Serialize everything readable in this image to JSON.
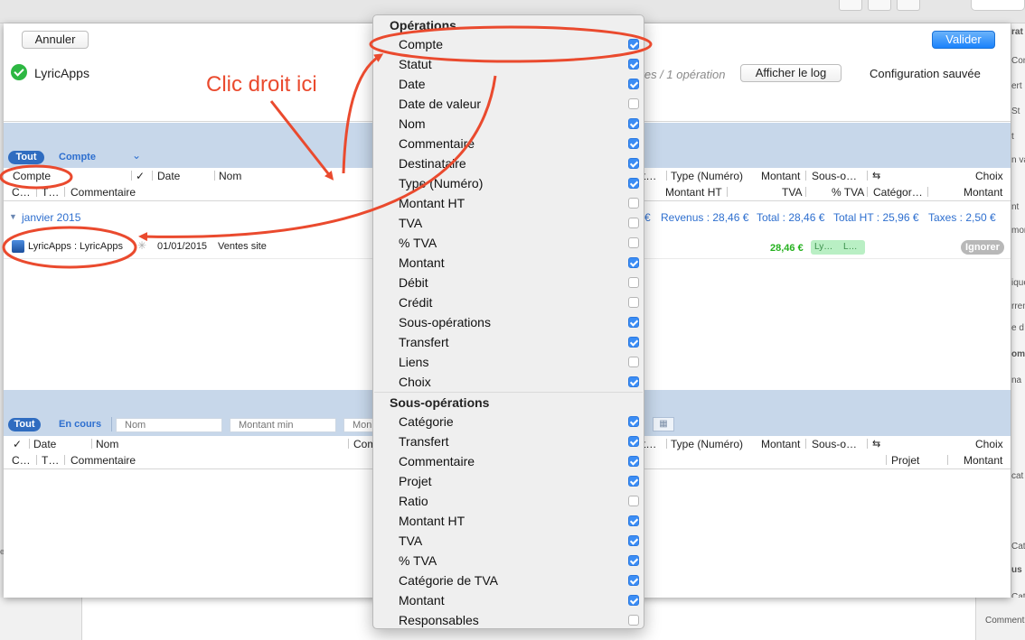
{
  "main": {
    "cancel_label": "Annuler",
    "validate_label": "Valider",
    "app_name": "LyricApps",
    "ops_summary": "ptes / 1 opération",
    "show_log_label": "Afficher le log",
    "config_saved": "Configuration sauvée"
  },
  "upper": {
    "tab_all": "Tout",
    "tab_account": "Compte",
    "headers_row1": {
      "compte": "Compte",
      "check": "✓",
      "date": "Date",
      "nom": "Nom",
      "t_abbr": "t…",
      "type": "Type (Numéro)",
      "montant": "Montant",
      "sous": "Sous-o…",
      "choix": "Choix"
    },
    "headers_row2": {
      "c": "C…",
      "t": "T…",
      "commentaire": "Commentaire",
      "montant_ht": "Montant HT",
      "tva": "TVA",
      "pct_tva": "% TVA",
      "categorie": "Catégor…",
      "montant": "Montant"
    },
    "group": {
      "label": "janvier 2015",
      "euro_frag": "€",
      "revenus": "Revenus : 28,46 €",
      "total": "Total : 28,46 €",
      "total_ht": "Total HT : 25,96 €",
      "taxes": "Taxes : 2,50 €"
    },
    "row": {
      "account": "LyricApps : LyricApps",
      "date": "01/01/2015",
      "name": "Ventes site",
      "amount": "28,46 €",
      "tag1": "Ly…",
      "tag2": "L…",
      "ignore_label": "Ignorer"
    }
  },
  "lower": {
    "tab_all": "Tout",
    "tab_in_progress": "En cours",
    "filter_name_placeholder": "Nom",
    "filter_min_placeholder": "Montant min",
    "filter_mon_placeholder": "Mon",
    "headers_row1": {
      "check": "✓",
      "date": "Date",
      "nom": "Nom",
      "com": "Com",
      "t_abbr": "t…",
      "type": "Type (Numéro)",
      "montant": "Montant",
      "sous": "Sous-o…",
      "choix": "Choix"
    },
    "headers_row2": {
      "c": "C…",
      "t": "T…",
      "commentaire": "Commentaire",
      "projet": "Projet",
      "montant": "Montant"
    }
  },
  "menu": {
    "section1_title": "Opérations",
    "section1_items": [
      {
        "label": "Compte",
        "checked": true
      },
      {
        "label": "Statut",
        "checked": true
      },
      {
        "label": "Date",
        "checked": true
      },
      {
        "label": "Date de valeur",
        "checked": false
      },
      {
        "label": "Nom",
        "checked": true
      },
      {
        "label": "Commentaire",
        "checked": true
      },
      {
        "label": "Destinataire",
        "checked": true
      },
      {
        "label": "Type (Numéro)",
        "checked": true
      },
      {
        "label": "Montant HT",
        "checked": false
      },
      {
        "label": "TVA",
        "checked": false
      },
      {
        "label": "% TVA",
        "checked": false
      },
      {
        "label": "Montant",
        "checked": true
      },
      {
        "label": "Débit",
        "checked": false
      },
      {
        "label": "Crédit",
        "checked": false
      },
      {
        "label": "Sous-opérations",
        "checked": true
      },
      {
        "label": "Transfert",
        "checked": true
      },
      {
        "label": "Liens",
        "checked": false
      },
      {
        "label": "Choix",
        "checked": true
      }
    ],
    "section2_title": "Sous-opérations",
    "section2_items": [
      {
        "label": "Catégorie",
        "checked": true
      },
      {
        "label": "Transfert",
        "checked": true
      },
      {
        "label": "Commentaire",
        "checked": true
      },
      {
        "label": "Projet",
        "checked": true
      },
      {
        "label": "Ratio",
        "checked": false
      },
      {
        "label": "Montant HT",
        "checked": true
      },
      {
        "label": "TVA",
        "checked": true
      },
      {
        "label": "% TVA",
        "checked": true
      },
      {
        "label": "Catégorie de TVA",
        "checked": true
      },
      {
        "label": "Montant",
        "checked": true
      },
      {
        "label": "Responsables",
        "checked": false
      }
    ]
  },
  "annotation": {
    "text": "Clic droit ici",
    "color": "#ea4a2e"
  },
  "background": {
    "side_fragments": [
      "rat",
      "Conf",
      "ert",
      "St",
      "t",
      "n va",
      "nt",
      "mon",
      "ique",
      "rren",
      "e d",
      "omm",
      "na",
      "cat",
      "Cat",
      "us",
      "Cat"
    ],
    "bottom_fragment": "Comment",
    "left_fragment": "e"
  }
}
